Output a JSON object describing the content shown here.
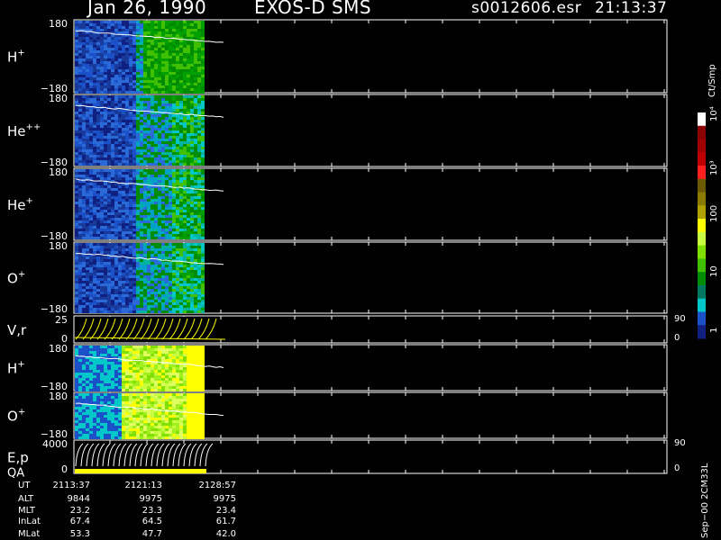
{
  "header": {
    "date": "Jan 26, 1990",
    "instrument": "EXOS-D SMS",
    "file": "s0012606.esr",
    "time": "21:13:37"
  },
  "colorbar": {
    "unit": "Ct/Smp",
    "labels": [
      "10⁴",
      "10³",
      "100",
      "10",
      "1"
    ],
    "colors": [
      "#ffffff",
      "#8b0000",
      "#a00000",
      "#c00000",
      "#ff2020",
      "#6b5a00",
      "#8b7a00",
      "#b0a000",
      "#ffff00",
      "#c8ff40",
      "#80e000",
      "#40c000",
      "#008c00",
      "#007860",
      "#00c8c8",
      "#1a50c8",
      "#102080"
    ]
  },
  "panels": [
    {
      "label": "H",
      "sup": "+",
      "ymax": "180",
      "ymin": "−180"
    },
    {
      "label": "He",
      "sup": "++",
      "ymax": "180",
      "ymin": "−180"
    },
    {
      "label": "He",
      "sup": "+",
      "ymax": "180",
      "ymin": "−180"
    },
    {
      "label": "O",
      "sup": "+",
      "ymax": "180",
      "ymin": "−180"
    },
    {
      "label": "V,r",
      "sup": "",
      "ymax": "25",
      "ymin": "0",
      "rtop": "90",
      "rbot": "0"
    },
    {
      "label": "H",
      "sup": "+",
      "ymax": "180",
      "ymin": "−180"
    },
    {
      "label": "O",
      "sup": "+",
      "ymax": "180",
      "ymin": "−180"
    },
    {
      "label": "E,p",
      "label2": "QA",
      "sup": "",
      "ymax": "4000",
      "ymin": "0",
      "rtop": "90",
      "rbot": "0"
    }
  ],
  "footer": {
    "rows": [
      {
        "name": "UT",
        "values": [
          "2113:37",
          "2121:13",
          "2128:57"
        ]
      },
      {
        "name": "ALT",
        "values": [
          "9844",
          "9975",
          "9975"
        ]
      },
      {
        "name": "MLT",
        "values": [
          "23.2",
          "23.3",
          "23.4"
        ]
      },
      {
        "name": "InLat",
        "values": [
          "67.4",
          "64.5",
          "61.7"
        ]
      },
      {
        "name": "MLat",
        "values": [
          "53.3",
          "47.7",
          "42.0"
        ]
      }
    ],
    "version": "Sep−00 2CM33L"
  },
  "chart_data": {
    "type": "heatmap",
    "title": "Jan 26, 1990   EXOS-D SMS",
    "ylim": [
      -180,
      180
    ],
    "x": [
      "2113:37",
      "2121:13",
      "2128:57"
    ],
    "series": [
      {
        "name": "H+"
      },
      {
        "name": "He++"
      },
      {
        "name": "He+"
      },
      {
        "name": "O+"
      },
      {
        "name": "V,r"
      },
      {
        "name": "H+"
      },
      {
        "name": "O+"
      },
      {
        "name": "E,p"
      }
    ]
  }
}
